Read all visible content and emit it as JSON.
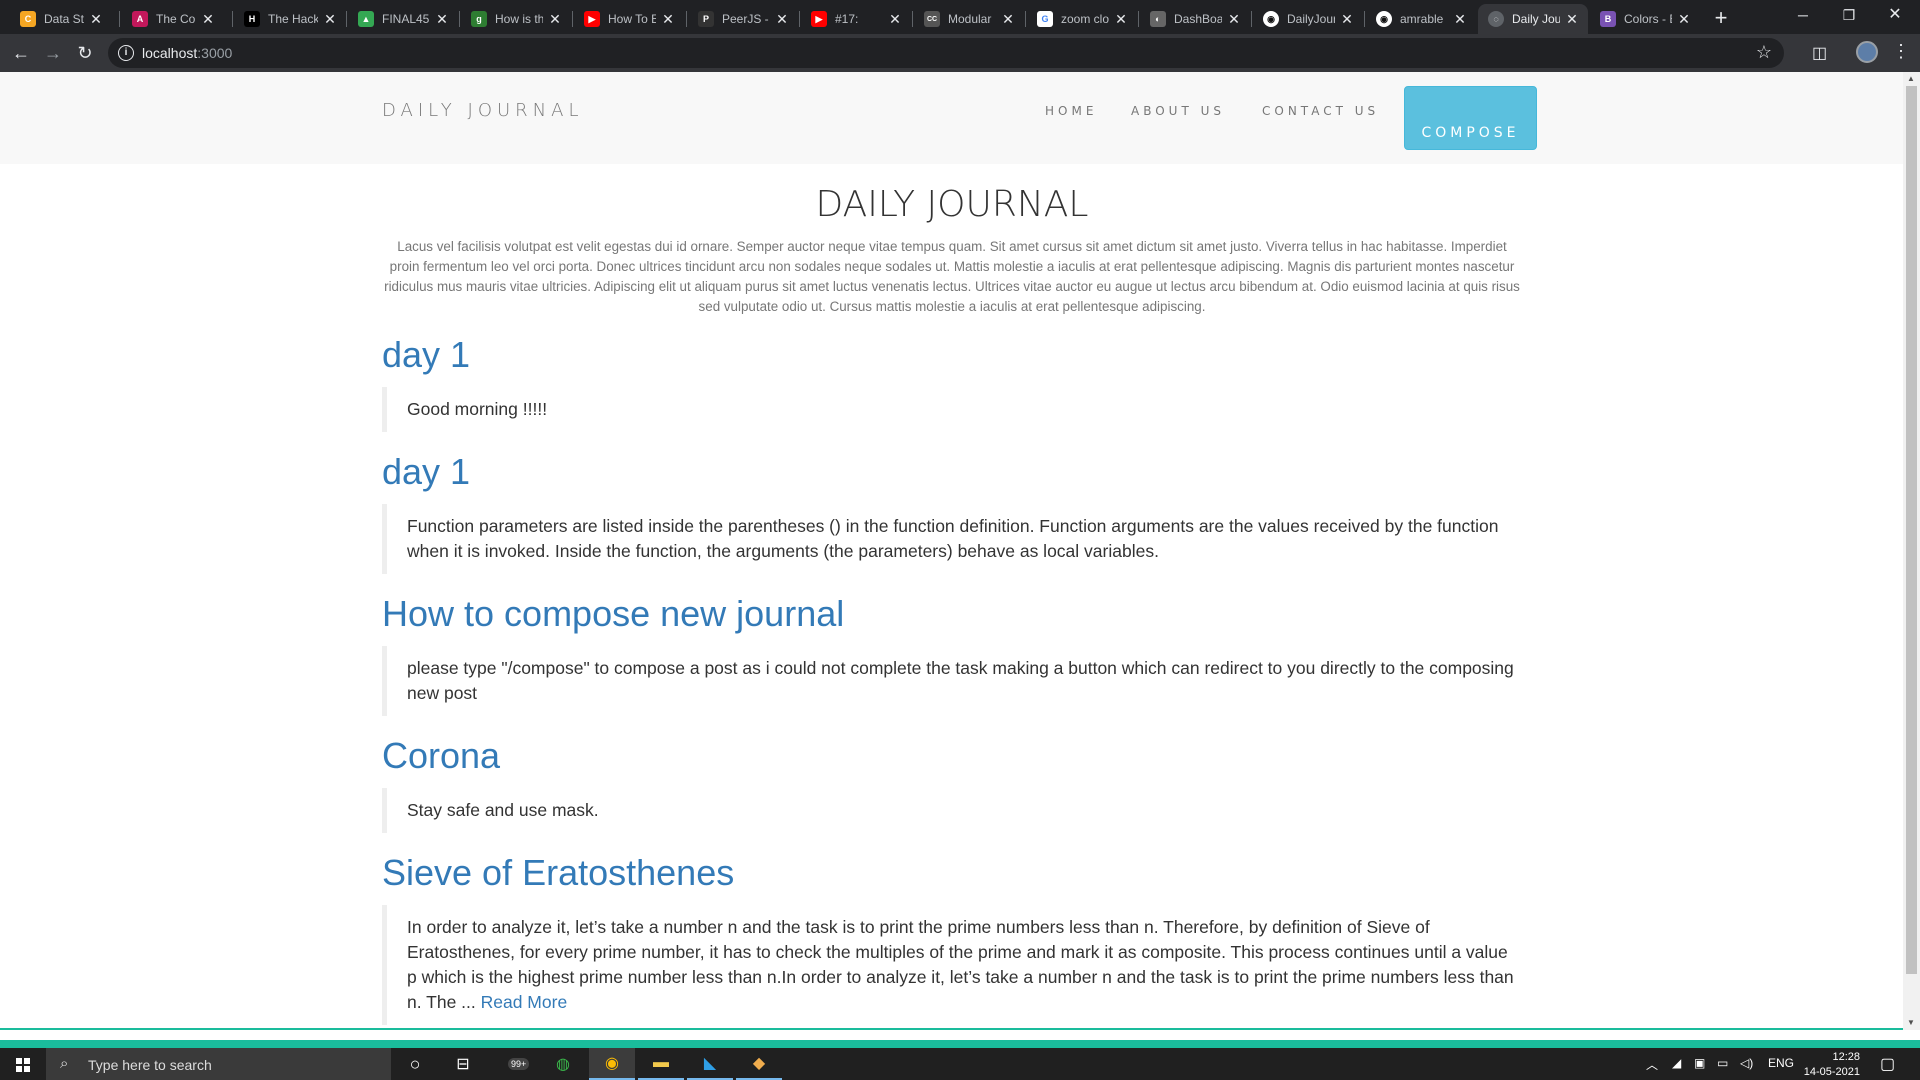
{
  "browser": {
    "tabs": [
      {
        "title": "Data Stru",
        "favicon_color": "#f5a623",
        "favicon_glyph": "C",
        "active": false
      },
      {
        "title": "The Com",
        "favicon_color": "#c2185b",
        "favicon_glyph": "A",
        "active": false
      },
      {
        "title": "The Hack",
        "favicon_color": "#000000",
        "favicon_glyph": "H",
        "active": false
      },
      {
        "title": "FINAL45",
        "favicon_color": "#34a853",
        "favicon_glyph": "▲",
        "active": false
      },
      {
        "title": "How is th",
        "favicon_color": "#2e7d32",
        "favicon_glyph": "g",
        "active": false
      },
      {
        "title": "How To E",
        "favicon_color": "#ff0000",
        "favicon_glyph": "▶",
        "active": false
      },
      {
        "title": "PeerJS - S",
        "favicon_color": "#333333",
        "favicon_glyph": "P",
        "active": false
      },
      {
        "title": "#17: ",
        "favicon_color": "#ff0000",
        "favicon_glyph": "▶",
        "active": false
      },
      {
        "title": "Modular",
        "favicon_color": "#555555",
        "favicon_glyph": "CC",
        "active": false
      },
      {
        "title": "zoom clo",
        "favicon_color": "#4285f4",
        "favicon_glyph": "G",
        "active": false
      },
      {
        "title": "DashBoa",
        "favicon_color": "#666666",
        "favicon_glyph": "◐",
        "active": false
      },
      {
        "title": "DailyJour",
        "favicon_color": "#111111",
        "favicon_glyph": "◉",
        "active": false
      },
      {
        "title": "amrable",
        "favicon_color": "#111111",
        "favicon_glyph": "◉",
        "active": false
      },
      {
        "title": "Daily Jou",
        "favicon_color": "#5f6368",
        "favicon_glyph": "◌",
        "active": true
      },
      {
        "title": "Colors - B",
        "favicon_color": "#7952b3",
        "favicon_glyph": "B",
        "active": false
      }
    ],
    "url_host": "localhost",
    "url_port": ":3000"
  },
  "site": {
    "brand": "DAILY JOURNAL",
    "nav": {
      "home": "HOME",
      "about": "ABOUT US",
      "contact": "CONTACT US",
      "compose": "COMPOSE"
    },
    "heading": "DAILY JOURNAL",
    "intro": "Lacus vel facilisis volutpat est velit egestas dui id ornare. Semper auctor neque vitae tempus quam. Sit amet cursus sit amet dictum sit amet justo. Viverra tellus in hac habitasse. Imperdiet proin fermentum leo vel orci porta. Donec ultrices tincidunt arcu non sodales neque sodales ut. Mattis molestie a iaculis at erat pellentesque adipiscing. Magnis dis parturient montes nascetur ridiculus mus mauris vitae ultricies. Adipiscing elit ut aliquam purus sit amet luctus venenatis lectus. Ultrices vitae auctor eu augue ut lectus arcu bibendum at. Odio euismod lacinia at quis risus sed vulputate odio ut. Cursus mattis molestie a iaculis at erat pellentesque adipiscing.",
    "posts": [
      {
        "title": "day 1",
        "body": "Good morning !!!!!"
      },
      {
        "title": "day 1",
        "body": "Function parameters are listed inside the parentheses () in the function definition. Function arguments are the values received by the function when it is invoked. Inside the function, the arguments (the parameters) behave as local variables."
      },
      {
        "title": "How to compose new journal",
        "body": "please type \"/compose\" to compose a post as i could not complete the task making a button which can redirect to you directly to the composing new post"
      },
      {
        "title": "Corona",
        "body": "Stay safe and use mask."
      },
      {
        "title": "Sieve of Eratosthenes",
        "body": "In order to analyze it, let’s take a number n and the task is to print the prime numbers less than n. Therefore, by definition of Sieve of Eratosthenes, for every prime number, it has to check the multiples of the prime and mark it as composite. This process continues until a value p which is the highest prime number less than n.In order to analyze it, let’s take a number n and the task is to print the prime numbers less than n. The ... ",
        "link": "Read More"
      }
    ]
  },
  "taskbar": {
    "search_placeholder": "Type here to search",
    "mail_badge": "99+",
    "language": "ENG",
    "time": "12:28",
    "date": "14-05-2021"
  }
}
